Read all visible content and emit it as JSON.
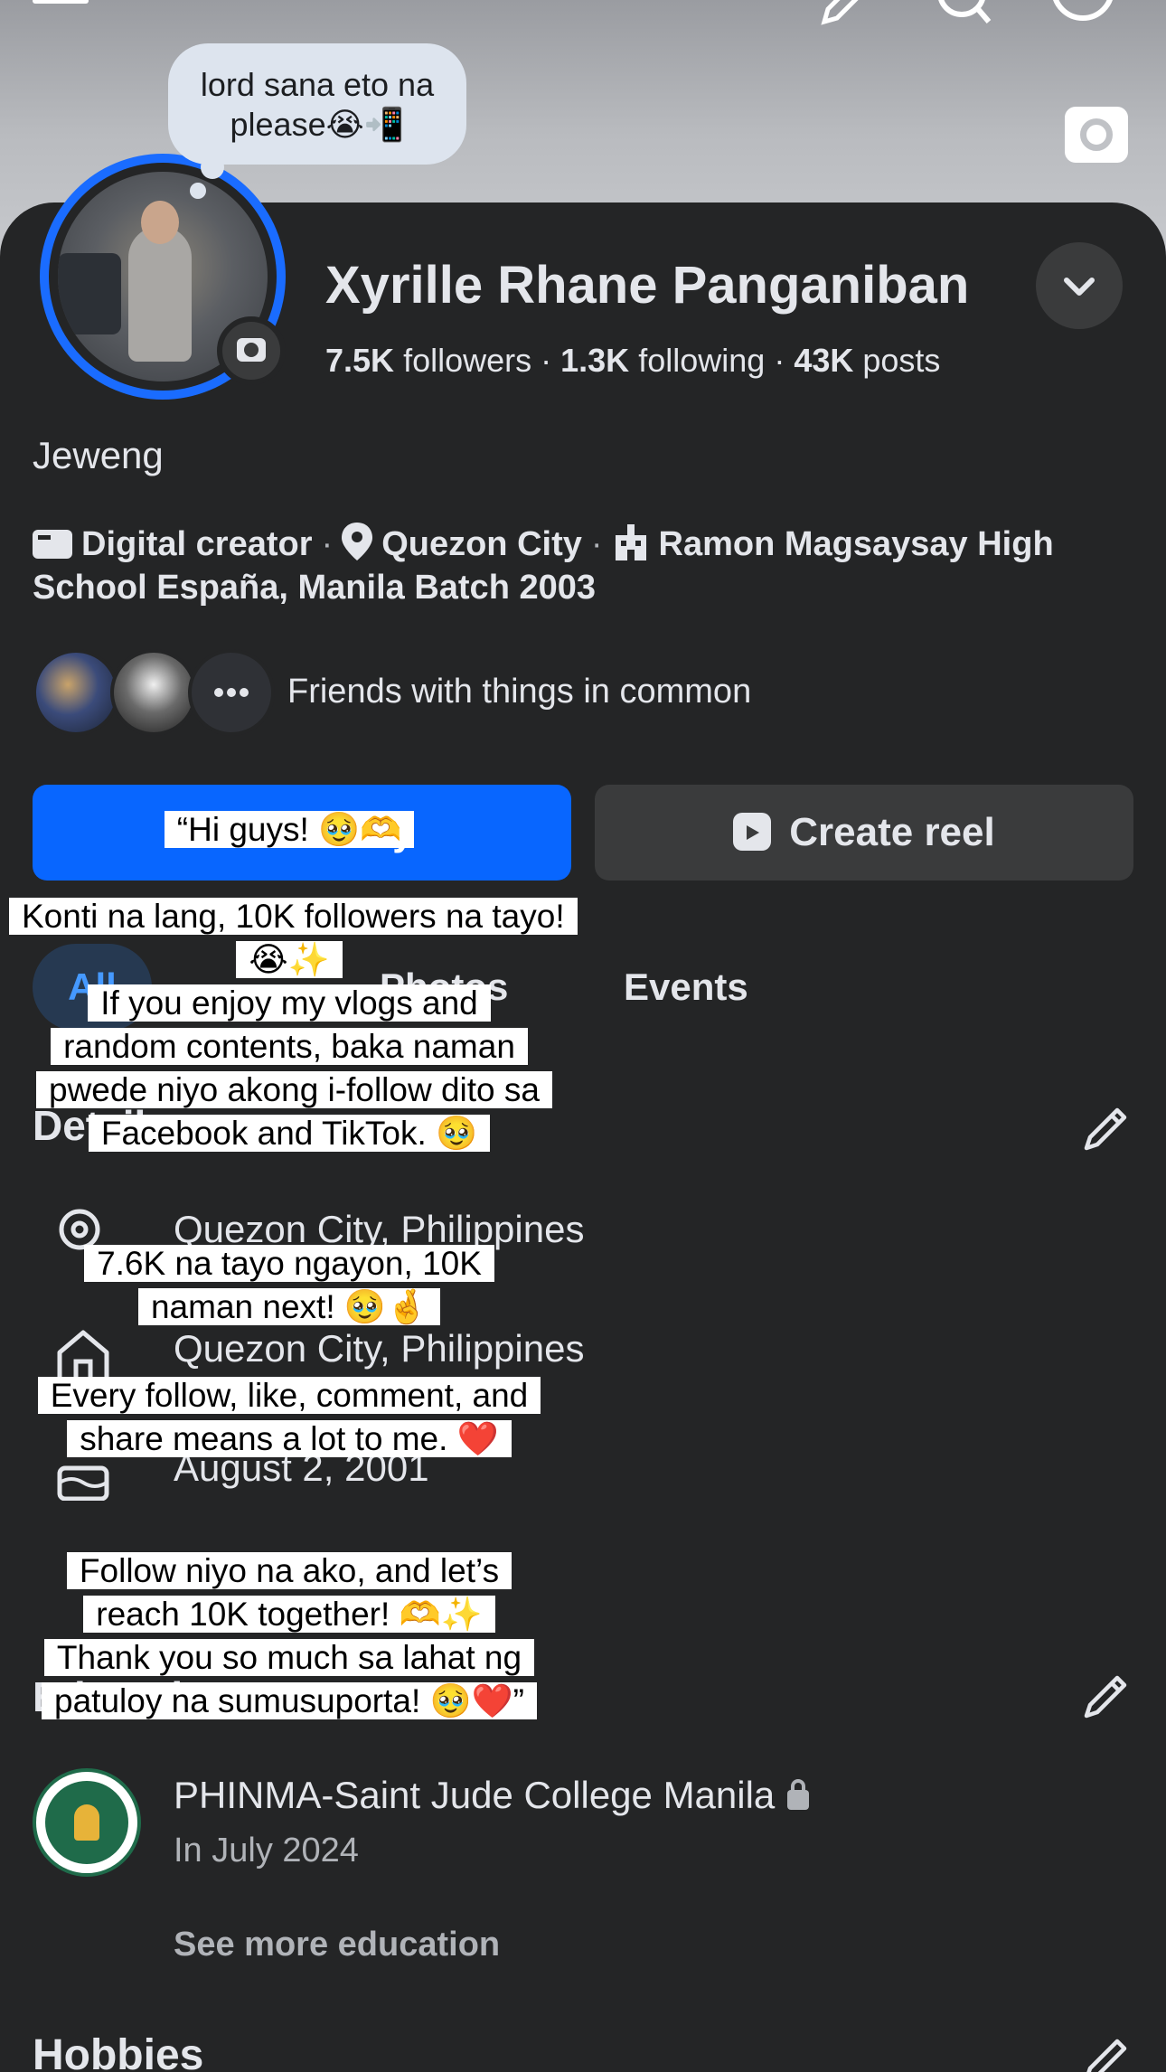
{
  "profile": {
    "note": "lord sana eto na please😭📲",
    "name": "Xyrille Rhane Panganiban",
    "followers_count": "7.5K",
    "followers_label": "followers",
    "following_count": "1.3K",
    "following_label": "following",
    "posts_count": "43K",
    "posts_label": "posts",
    "bio": "Jeweng",
    "category": "Digital creator",
    "location": "Quezon City",
    "school": "Ramon Magsaysay High School España, Manila Batch 2003",
    "friends_label": "Friends with things in common"
  },
  "actions": {
    "primary_label": "Add to story",
    "secondary_label": "Create reel"
  },
  "tabs": [
    "All",
    "Photos",
    "Events"
  ],
  "details": {
    "heading": "Details",
    "current_city": "Quezon City, Philippines",
    "hometown": "Quezon City, Philippines",
    "birthday": "August 2, 2001"
  },
  "education": {
    "heading": "Education",
    "school_name": "PHINMA-Saint Jude College Manila",
    "school_since": "In July 2024",
    "see_more": "See more education"
  },
  "hobbies": {
    "heading": "Hobbies"
  },
  "caption_overlay": {
    "line1": "“Hi guys! 🥹🫶",
    "line2": "Konti na lang, 10K followers na tayo! 😭✨",
    "line3": "If you enjoy my vlogs and random contents, baka naman pwede niyo akong i-follow dito sa Facebook and TikTok. 🥹",
    "line4": "7.6K na tayo ngayon, 10K naman next! 🥹🤞",
    "line5": "Every follow, like, comment, and share means a lot to me. ❤️",
    "line6": "Follow niyo na ako, and let’s reach 10K together! 🫶✨",
    "line7": "Thank you so much sa lahat ng patuloy na sumusuporta! 🥹❤️”"
  },
  "colors": {
    "background": "#242526",
    "accent": "#0866ff",
    "story_ring": "#1a6cff",
    "text": "#e4e6eb",
    "secondary_text": "#b0b3b8"
  }
}
